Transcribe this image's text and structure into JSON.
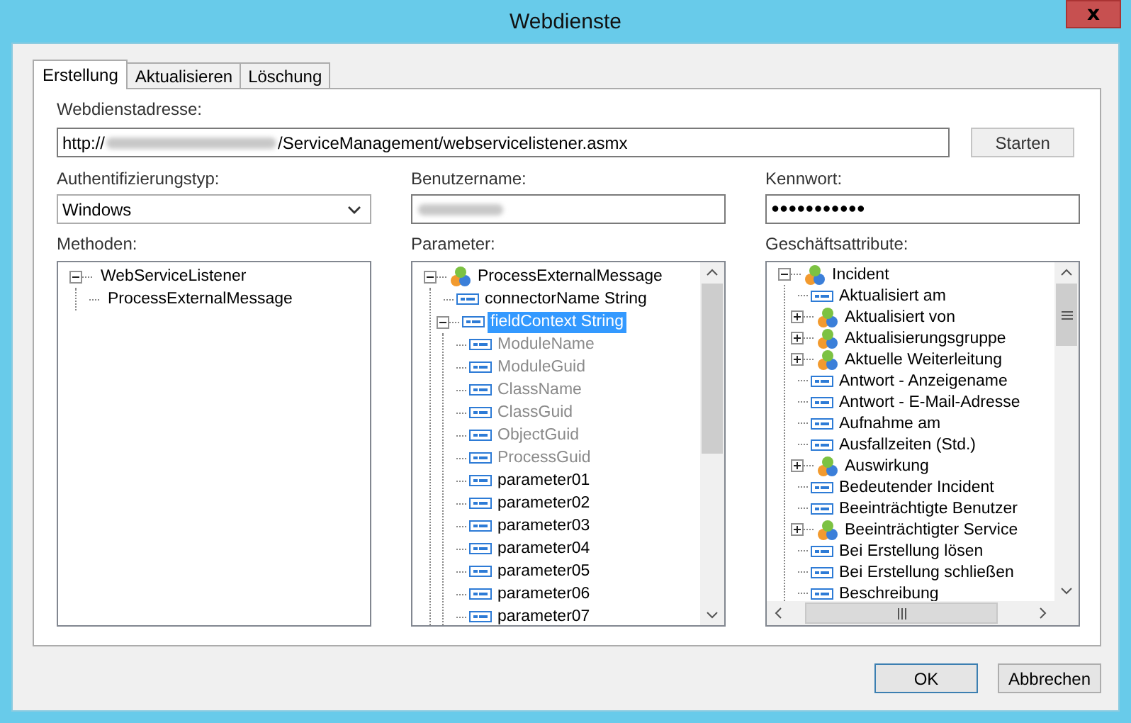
{
  "window": {
    "title": "Webdienste",
    "close": "x"
  },
  "tabs": [
    {
      "label": "Erstellung",
      "selected": true
    },
    {
      "label": "Aktualisieren",
      "selected": false
    },
    {
      "label": "Löschung",
      "selected": false
    }
  ],
  "address": {
    "label": "Webdienstadresse:",
    "value_start": "http://",
    "value_end": "/ServiceManagement/webservicelistener.asmx",
    "redacted": true,
    "button": "Starten"
  },
  "auth": {
    "label": "Authentifizierungstyp:",
    "value": "Windows"
  },
  "username": {
    "label": "Benutzername:",
    "redacted": true
  },
  "password": {
    "label": "Kennwort:",
    "value": "●●●●●●●●●●●"
  },
  "methods": {
    "label": "Methoden:",
    "tree": [
      {
        "label": "WebServiceListener",
        "selected": false,
        "expanded": true,
        "children": [
          {
            "label": "ProcessExternalMessage",
            "selected": false
          }
        ]
      }
    ]
  },
  "parameters": {
    "label": "Parameter:",
    "tree": [
      {
        "label": "ProcessExternalMessage",
        "kind": "entity",
        "expanded": true,
        "selected": false,
        "disabled": false,
        "children": [
          {
            "label": "connectorName String",
            "kind": "field",
            "selected": false,
            "disabled": false
          },
          {
            "label": "fieldContext String",
            "kind": "field",
            "expanded": true,
            "selected": true,
            "disabled": false,
            "children": [
              {
                "label": "ModuleName",
                "kind": "field",
                "selected": false,
                "disabled": true
              },
              {
                "label": "ModuleGuid",
                "kind": "field",
                "selected": false,
                "disabled": true
              },
              {
                "label": "ClassName",
                "kind": "field",
                "selected": false,
                "disabled": true
              },
              {
                "label": "ClassGuid",
                "kind": "field",
                "selected": false,
                "disabled": true
              },
              {
                "label": "ObjectGuid",
                "kind": "field",
                "selected": false,
                "disabled": true
              },
              {
                "label": "ProcessGuid",
                "kind": "field",
                "selected": false,
                "disabled": true
              },
              {
                "label": "parameter01",
                "kind": "field",
                "selected": false,
                "disabled": false
              },
              {
                "label": "parameter02",
                "kind": "field",
                "selected": false,
                "disabled": false
              },
              {
                "label": "parameter03",
                "kind": "field",
                "selected": false,
                "disabled": false
              },
              {
                "label": "parameter04",
                "kind": "field",
                "selected": false,
                "disabled": false
              },
              {
                "label": "parameter05",
                "kind": "field",
                "selected": false,
                "disabled": false
              },
              {
                "label": "parameter06",
                "kind": "field",
                "selected": false,
                "disabled": false
              },
              {
                "label": "parameter07",
                "kind": "field",
                "selected": false,
                "disabled": false
              }
            ]
          }
        ]
      }
    ]
  },
  "attributes": {
    "label": "Geschäftsattribute:",
    "tree": [
      {
        "label": "Incident",
        "kind": "entity",
        "expanded": true,
        "selected": false,
        "children": [
          {
            "label": "Aktualisiert am",
            "kind": "field",
            "selected": false
          },
          {
            "label": "Aktualisiert von",
            "kind": "entity",
            "expanded": false,
            "selected": false
          },
          {
            "label": "Aktualisierungsgruppe",
            "kind": "entity",
            "expanded": false,
            "selected": false
          },
          {
            "label": "Aktuelle Weiterleitung",
            "kind": "entity",
            "expanded": false,
            "selected": false
          },
          {
            "label": "Antwort - Anzeigename",
            "kind": "field",
            "selected": false
          },
          {
            "label": "Antwort - E-Mail-Adresse",
            "kind": "field",
            "selected": false
          },
          {
            "label": "Aufnahme am",
            "kind": "field",
            "selected": false
          },
          {
            "label": "Ausfallzeiten (Std.)",
            "kind": "field",
            "selected": false
          },
          {
            "label": "Auswirkung",
            "kind": "entity",
            "expanded": false,
            "selected": false
          },
          {
            "label": "Bedeutender Incident",
            "kind": "field",
            "selected": false
          },
          {
            "label": "Beeinträchtigte Benutzer",
            "kind": "field",
            "selected": false
          },
          {
            "label": "Beeinträchtigter Service",
            "kind": "entity",
            "expanded": false,
            "selected": false
          },
          {
            "label": "Bei Erstellung lösen",
            "kind": "field",
            "selected": false
          },
          {
            "label": "Bei Erstellung schließen",
            "kind": "field",
            "selected": false
          },
          {
            "label": "Beschreibung",
            "kind": "field",
            "selected": false
          }
        ]
      }
    ]
  },
  "buttons": [
    "OK",
    "Abbrechen"
  ]
}
